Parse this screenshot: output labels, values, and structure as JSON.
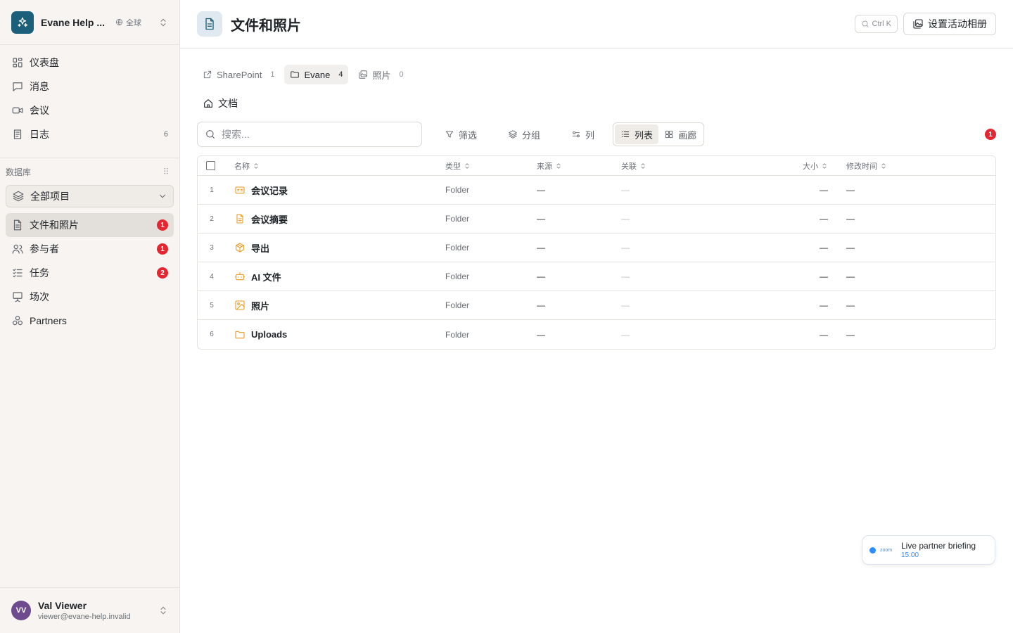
{
  "workspace": {
    "name": "Evane Help ...",
    "scope": "全球"
  },
  "nav": {
    "items": [
      {
        "label": "仪表盘",
        "icon": "dashboard-icon"
      },
      {
        "label": "消息",
        "icon": "message-icon"
      },
      {
        "label": "会议",
        "icon": "video-icon"
      },
      {
        "label": "日志",
        "icon": "log-icon",
        "count": "6"
      }
    ]
  },
  "database": {
    "label": "数据库",
    "selector": "全部项目",
    "items": [
      {
        "label": "文件和照片",
        "icon": "file-icon",
        "badge": "1",
        "active": true
      },
      {
        "label": "参与者",
        "icon": "users-icon",
        "badge": "1"
      },
      {
        "label": "任务",
        "icon": "tasks-icon",
        "badge": "2"
      },
      {
        "label": "场次",
        "icon": "presentation-icon"
      },
      {
        "label": "Partners",
        "icon": "partners-icon"
      }
    ]
  },
  "user": {
    "initials": "VV",
    "name": "Val Viewer",
    "email": "viewer@evane-help.invalid"
  },
  "header": {
    "title": "文件和照片",
    "shortcut": "Ctrl K",
    "album_button": "设置活动相册"
  },
  "tabs": [
    {
      "label": "SharePoint",
      "count": "1",
      "icon": "external-link-icon"
    },
    {
      "label": "Evane",
      "count": "4",
      "icon": "folder-icon",
      "active": true
    },
    {
      "label": "照片",
      "count": "0",
      "icon": "images-icon"
    }
  ],
  "breadcrumb": {
    "label": "文档"
  },
  "toolbar": {
    "search_placeholder": "搜索...",
    "filter": "筛选",
    "group": "分组",
    "columns": "列",
    "view_list": "列表",
    "view_gallery": "画廊",
    "notification_count": "1"
  },
  "table": {
    "headers": {
      "name": "名称",
      "type": "类型",
      "source": "来源",
      "related": "关联",
      "size": "大小",
      "modified": "修改时间"
    },
    "rows": [
      {
        "num": "1",
        "name": "会议记录",
        "icon": "id-card-icon",
        "type": "Folder",
        "source": "—",
        "related": "—",
        "size": "—",
        "modified": "—"
      },
      {
        "num": "2",
        "name": "会议摘要",
        "icon": "document-icon",
        "type": "Folder",
        "source": "—",
        "related": "—",
        "size": "—",
        "modified": "—"
      },
      {
        "num": "3",
        "name": "导出",
        "icon": "package-icon",
        "type": "Folder",
        "source": "—",
        "related": "—",
        "size": "—",
        "modified": "—"
      },
      {
        "num": "4",
        "name": "AI 文件",
        "icon": "bot-icon",
        "type": "Folder",
        "source": "—",
        "related": "—",
        "size": "—",
        "modified": "—"
      },
      {
        "num": "5",
        "name": "照片",
        "icon": "image-icon",
        "type": "Folder",
        "source": "—",
        "related": "—",
        "size": "—",
        "modified": "—"
      },
      {
        "num": "6",
        "name": "Uploads",
        "icon": "folder-icon",
        "type": "Folder",
        "source": "—",
        "related": "—",
        "size": "—",
        "modified": "—"
      }
    ]
  },
  "meeting_popup": {
    "brand": "zoom",
    "title": "Live partner briefing",
    "time": "15:00"
  },
  "colors": {
    "accent": "#1b5f7a",
    "badge": "#e5252f",
    "folder": "#e79a1e",
    "zoom": "#2d8cff"
  }
}
